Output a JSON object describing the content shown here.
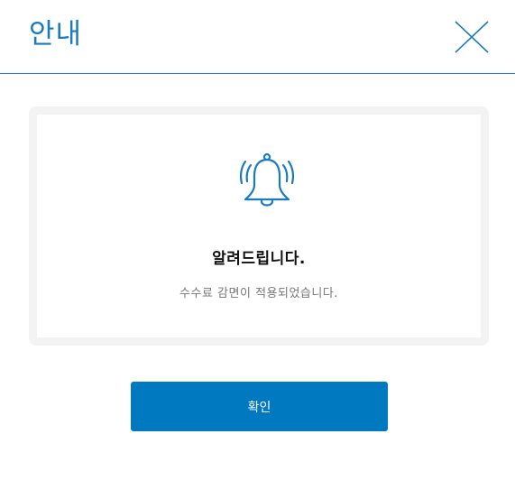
{
  "dialog": {
    "title": "안내",
    "close_icon": "close-icon"
  },
  "notice": {
    "icon": "bell-ringing-icon",
    "heading": "알려드립니다.",
    "message": "수수료 감면이 적용되었습니다."
  },
  "actions": {
    "confirm_label": "확인"
  },
  "colors": {
    "accent": "#0079c1",
    "title": "#1a7ac0",
    "panel_bg": "#f3f3f3",
    "heading_text": "#111111",
    "message_text": "#777777"
  }
}
